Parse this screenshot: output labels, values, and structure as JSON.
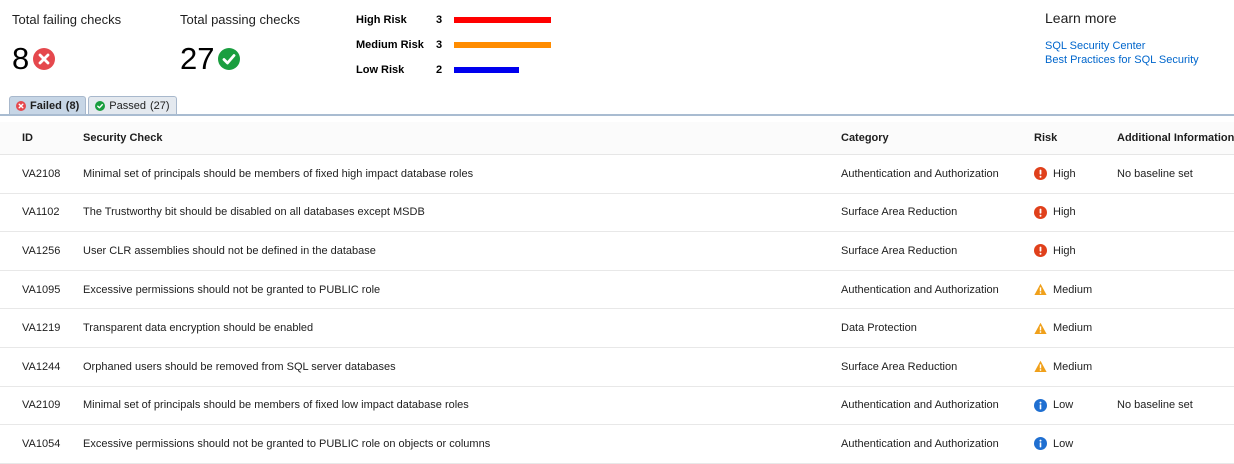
{
  "summary": {
    "failing_label": "Total failing checks",
    "failing_count": "8",
    "passing_label": "Total passing checks",
    "passing_count": "27",
    "risks": [
      {
        "name": "High Risk",
        "count": "3",
        "color": "#ff0000",
        "fraction": 1.0
      },
      {
        "name": "Medium Risk",
        "count": "3",
        "color": "#ff8c00",
        "fraction": 1.0
      },
      {
        "name": "Low Risk",
        "count": "2",
        "color": "#0000ee",
        "fraction": 0.667
      }
    ]
  },
  "learn_more": {
    "title": "Learn more",
    "links": [
      "SQL Security Center",
      "Best Practices for SQL Security"
    ]
  },
  "tabs": [
    {
      "label": "Failed",
      "count": "(8)",
      "active": true,
      "icon": "failed-icon"
    },
    {
      "label": "Passed",
      "count": "(27)",
      "active": false,
      "icon": "passed-icon"
    }
  ],
  "table": {
    "headers": {
      "id": "ID",
      "check": "Security Check",
      "category": "Category",
      "risk": "Risk",
      "info": "Additional Information"
    },
    "rows": [
      {
        "id": "VA2108",
        "check": "Minimal set of principals should be members of fixed high impact database roles",
        "category": "Authentication and Authorization",
        "risk": "High",
        "info": "No baseline set"
      },
      {
        "id": "VA1102",
        "check": "The Trustworthy bit should be disabled on all databases except MSDB",
        "category": "Surface Area Reduction",
        "risk": "High",
        "info": ""
      },
      {
        "id": "VA1256",
        "check": "User CLR assemblies should not be defined in the database",
        "category": "Surface Area Reduction",
        "risk": "High",
        "info": ""
      },
      {
        "id": "VA1095",
        "check": "Excessive permissions should not be granted to PUBLIC role",
        "category": "Authentication and Authorization",
        "risk": "Medium",
        "info": ""
      },
      {
        "id": "VA1219",
        "check": "Transparent data encryption should be enabled",
        "category": "Data Protection",
        "risk": "Medium",
        "info": ""
      },
      {
        "id": "VA1244",
        "check": "Orphaned users should be removed from SQL server databases",
        "category": "Surface Area Reduction",
        "risk": "Medium",
        "info": ""
      },
      {
        "id": "VA2109",
        "check": "Minimal set of principals should be members of fixed low impact database roles",
        "category": "Authentication and Authorization",
        "risk": "Low",
        "info": "No baseline set"
      },
      {
        "id": "VA1054",
        "check": "Excessive permissions should not be granted to PUBLIC role on objects or columns",
        "category": "Authentication and Authorization",
        "risk": "Low",
        "info": ""
      }
    ]
  },
  "colors": {
    "fail": "#e5484d",
    "pass": "#1a9e3f",
    "high": "#e0401b",
    "medium": "#f0a01a",
    "low": "#1f6fd1",
    "link": "#0066cc"
  }
}
